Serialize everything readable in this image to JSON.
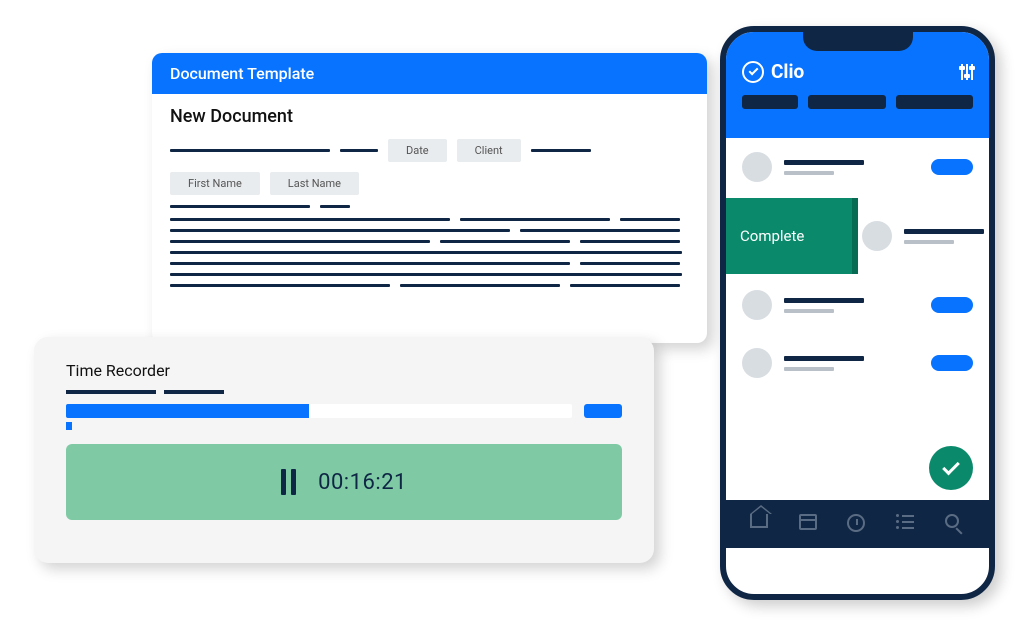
{
  "document": {
    "header": "Document Template",
    "title": "New Document",
    "fields": {
      "date": "Date",
      "client": "Client",
      "first_name": "First Name",
      "last_name": "Last Name"
    }
  },
  "timer": {
    "title": "Time Recorder",
    "elapsed": "00:16:21",
    "progress_pct": 48
  },
  "mobile": {
    "brand": "Clio",
    "complete_label": "Complete",
    "nav": [
      "home",
      "calendar",
      "clock",
      "list",
      "search"
    ]
  }
}
